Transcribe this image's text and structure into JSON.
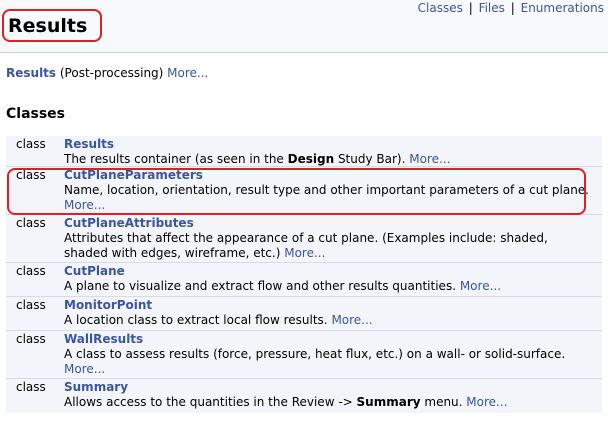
{
  "nav": {
    "classes": "Classes",
    "files": "Files",
    "enumerations": "Enumerations",
    "separator": "|"
  },
  "title": "Results",
  "namespace_line": {
    "link": "Results",
    "text": " (Post-processing) ",
    "more": "More..."
  },
  "classes_heading": "Classes",
  "classes": [
    {
      "keyword": "class",
      "name": "Results",
      "desc_a": "The results container (as seen in the ",
      "desc_b": "Design",
      "desc_c": " Study Bar). ",
      "more": "More..."
    },
    {
      "keyword": "class",
      "name": "CutPlaneParameters",
      "desc": "Name, location, orientation, result type and other important parameters of a cut plane. ",
      "more": "More..."
    },
    {
      "keyword": "class",
      "name": "CutPlaneAttributes",
      "desc": "Attributes that affect the appearance of a cut plane. (Examples include: shaded, shaded with edges, wireframe, etc.) ",
      "more": "More..."
    },
    {
      "keyword": "class",
      "name": "CutPlane",
      "desc": "A plane to visualize and extract flow and other results quantities. ",
      "more": "More..."
    },
    {
      "keyword": "class",
      "name": "MonitorPoint",
      "desc": "A location class to extract local flow results. ",
      "more": "More..."
    },
    {
      "keyword": "class",
      "name": "WallResults",
      "desc": "A class to assess results (force, pressure, heat flux, etc.) on a wall- or solid-surface. ",
      "more": "More..."
    },
    {
      "keyword": "class",
      "name": "Summary",
      "desc_a": "Allows access to the quantities in the Review -> ",
      "desc_b": "Summary",
      "desc_c": " menu. ",
      "more": "More..."
    }
  ],
  "colors": {
    "link": "#3a56a0",
    "highlight": "#e02020",
    "table_bg": "#f3f5fa"
  }
}
